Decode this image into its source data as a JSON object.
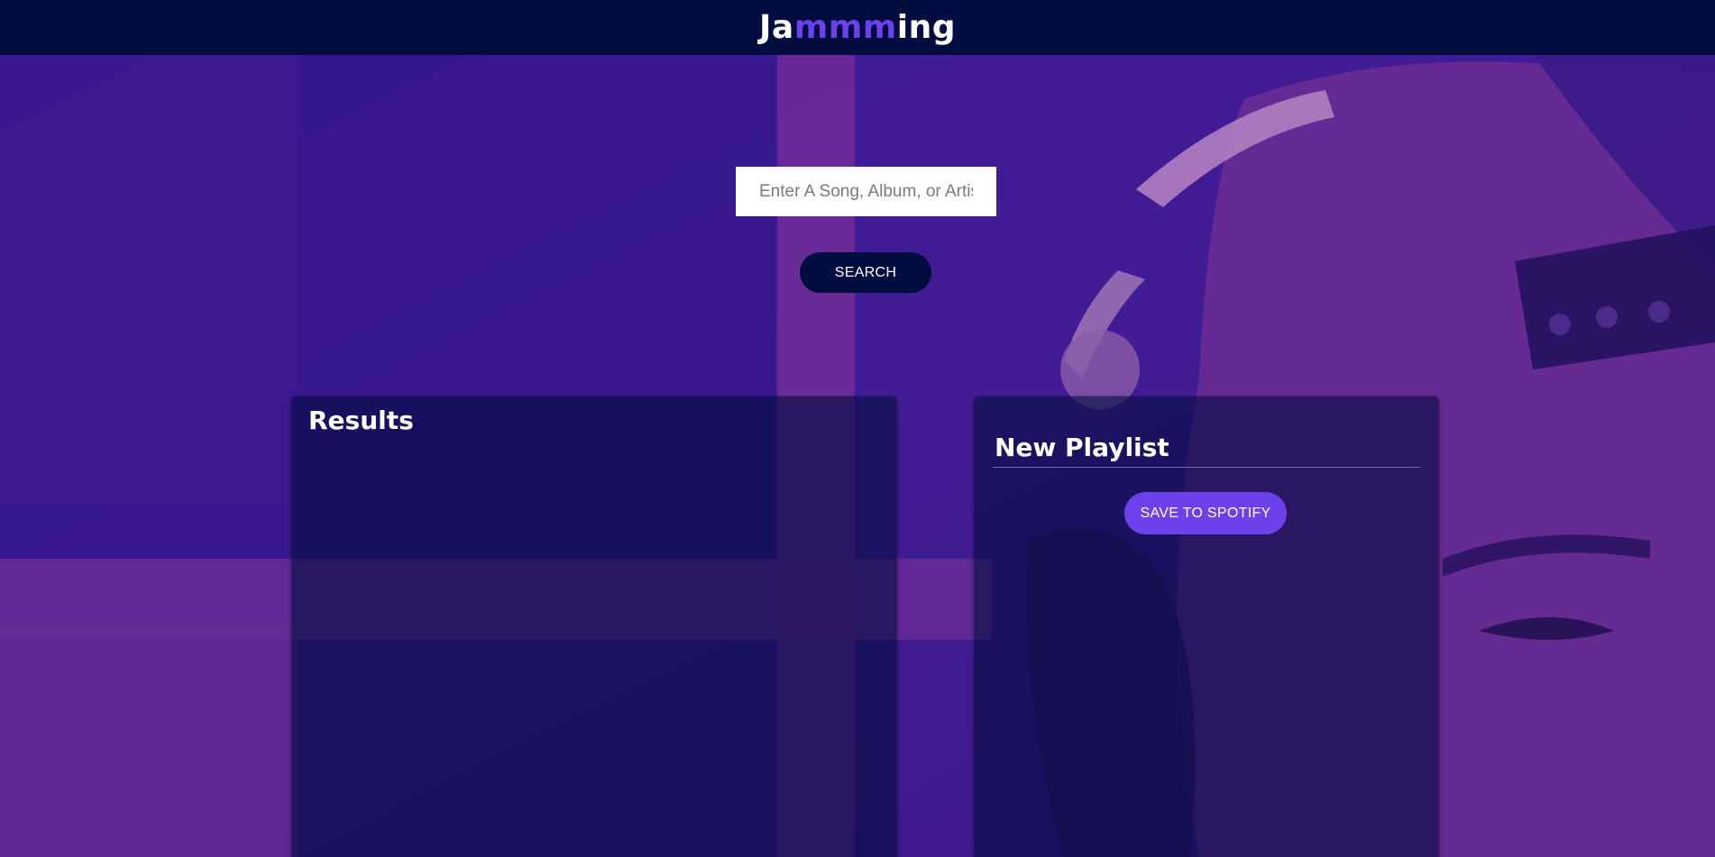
{
  "header": {
    "logo_part1": "Ja",
    "logo_accent": "mmm",
    "logo_part2": "ing"
  },
  "search": {
    "placeholder": "Enter A Song, Album, or Artist",
    "value": "",
    "button_label": "SEARCH"
  },
  "results": {
    "title": "Results",
    "tracks": []
  },
  "playlist": {
    "name": "New Playlist",
    "save_label": "SAVE TO SPOTIFY",
    "tracks": []
  },
  "colors": {
    "header_bg": "#010c3f",
    "accent": "#6c41ec",
    "background_purple": "#3a1a8f",
    "panel_bg": "rgba(1,12,63,0.6)",
    "text": "#ffffff"
  },
  "background_image": "purple-tinted photo of a person wearing headphones"
}
